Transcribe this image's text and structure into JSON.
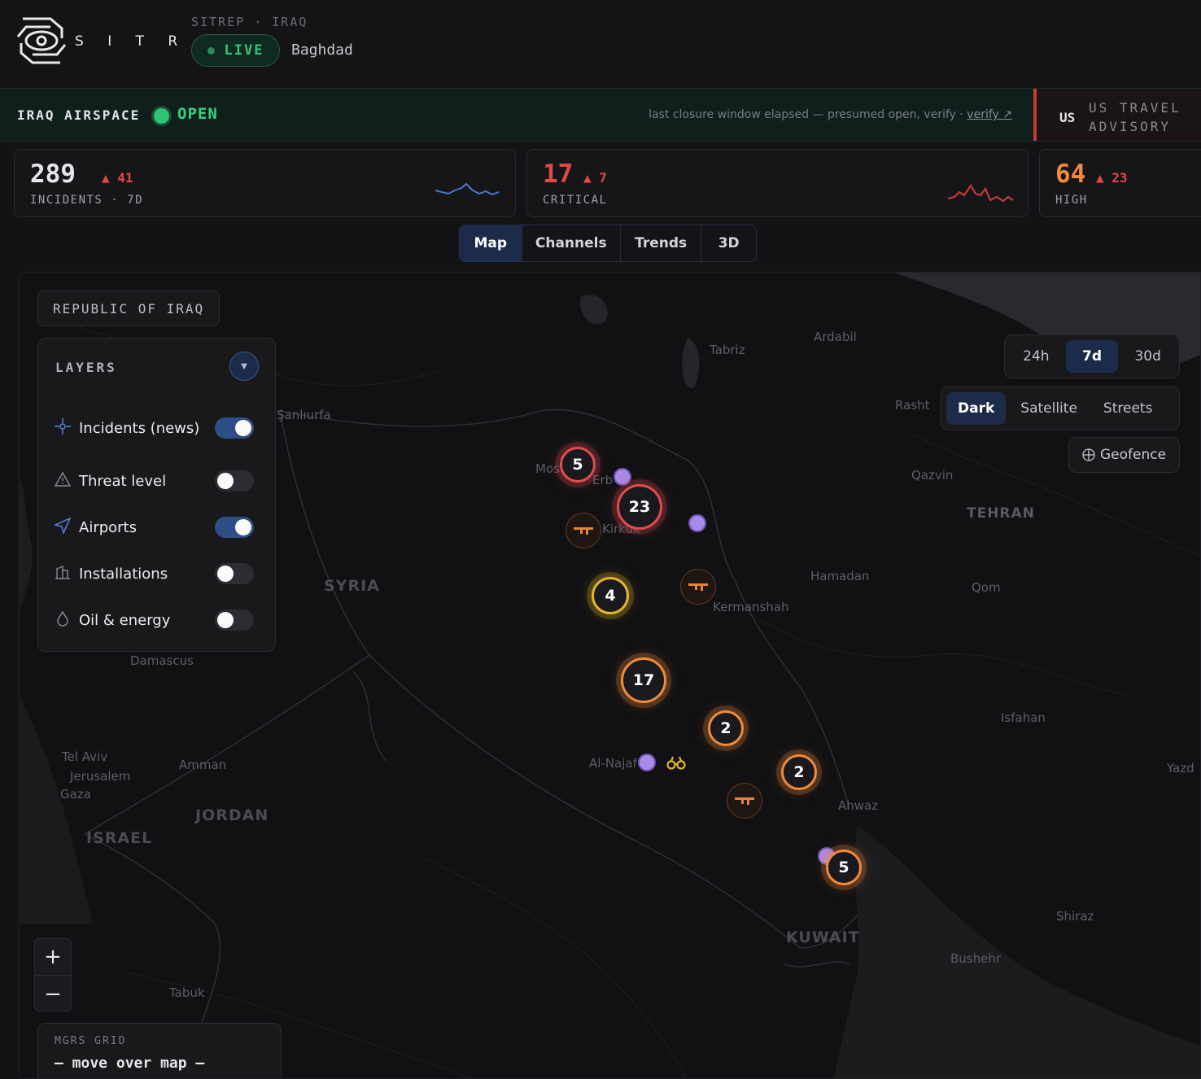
{
  "header": {
    "brand": "S I T R A Q",
    "subtitle": "SITREP · IRAQ",
    "live_label": "LIVE",
    "city": "Baghdad"
  },
  "airspace": {
    "label": "IRAQ AIRSPACE",
    "status": "OPEN",
    "note": "last closure window elapsed — presumed open, verify ·",
    "verify_link": "verify ↗",
    "advisory_country": "US",
    "advisory_text": "US TRAVEL ADVISORY"
  },
  "stats": [
    {
      "value": "289",
      "delta": "▲ 41",
      "label": "INCIDENTS · 7D",
      "color": "#ececf0",
      "spark_color": "#4a78c8"
    },
    {
      "value": "17",
      "delta": "▲ 7",
      "label": "CRITICAL",
      "color": "#e14848",
      "spark_color": "#d23b3b"
    },
    {
      "value": "64",
      "delta": "▲ 23",
      "label": "HIGH",
      "color": "#f08a3c",
      "spark_color": "#f08a3c"
    }
  ],
  "tabs": {
    "items": [
      "Map",
      "Channels",
      "Trends",
      "3D"
    ],
    "active": "Map"
  },
  "map": {
    "country_chip": "REPUBLIC OF IRAQ",
    "layers": {
      "title": "LAYERS",
      "items": [
        {
          "label": "Incidents (news)",
          "icon": "crosshair-icon",
          "on": true
        },
        {
          "label": "Threat level",
          "icon": "warning-icon",
          "on": false
        },
        {
          "label": "Airports",
          "icon": "navigation-icon",
          "on": true
        },
        {
          "label": "Installations",
          "icon": "building-icon",
          "on": false
        },
        {
          "label": "Oil & energy",
          "icon": "droplet-icon",
          "on": false
        }
      ]
    },
    "range": {
      "items": [
        "24h",
        "7d",
        "30d"
      ],
      "active": "7d"
    },
    "styles": {
      "items": [
        "Dark",
        "Satellite",
        "Streets"
      ],
      "active": "Dark"
    },
    "geofence_label": "Geofence",
    "mgrs": {
      "label": "MGRS GRID",
      "value": "— move over map —"
    },
    "clusters": [
      {
        "count": "5",
        "severity": "red"
      },
      {
        "count": "23",
        "severity": "red"
      },
      {
        "count": "4",
        "severity": "yellow"
      },
      {
        "count": "17",
        "severity": "orange"
      },
      {
        "count": "2",
        "severity": "orange"
      },
      {
        "count": "2",
        "severity": "orange"
      },
      {
        "count": "5",
        "severity": "orange"
      }
    ],
    "places": [
      "Tabriz",
      "Ardabil",
      "Rasht",
      "Şanlıurfa",
      "Qazvin",
      "TEHRAN",
      "Hamadan",
      "Qom",
      "Kermanshah",
      "SYRIA",
      "Damascus",
      "Isfahan",
      "Tel Aviv",
      "Jerusalem",
      "Gaza",
      "Amman",
      "JORDAN",
      "ISRAEL",
      "Al-Najaf",
      "Ahwaz",
      "Yazd",
      "KUWAIT",
      "Shiraz",
      "Bushehr",
      "Tabuk",
      "Mos",
      "Erb",
      "Kirkuk"
    ]
  }
}
